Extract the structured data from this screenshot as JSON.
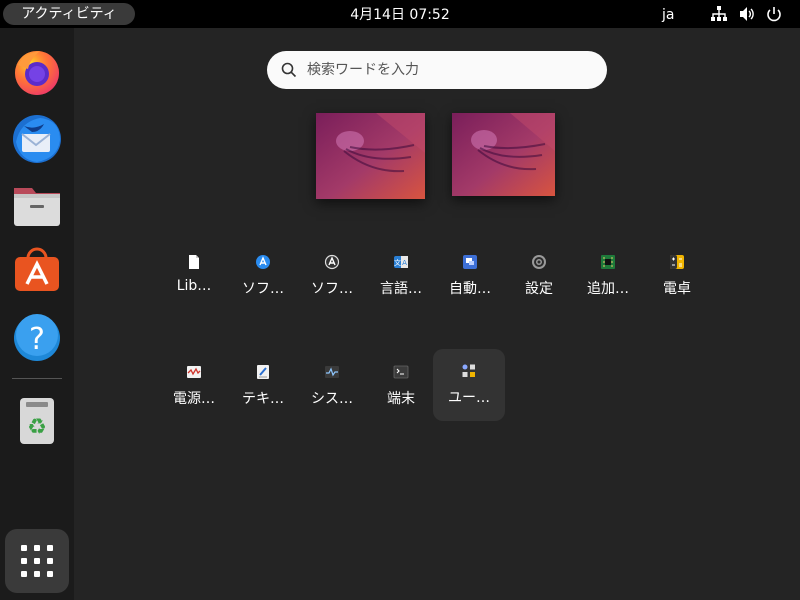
{
  "topbar": {
    "activities": "アクティビティ",
    "clock": "4月14日  07:52",
    "input_method": "ja",
    "tray_icons": [
      "network-icon",
      "volume-icon",
      "power-icon"
    ]
  },
  "dock": {
    "items": [
      {
        "name": "firefox-icon"
      },
      {
        "name": "thunderbird-icon"
      },
      {
        "name": "files-icon"
      },
      {
        "name": "app-center-icon"
      },
      {
        "name": "help-icon"
      },
      {
        "name": "trash-icon"
      }
    ],
    "show_apps": "app-grid-icon"
  },
  "search": {
    "placeholder": "検索ワードを入力"
  },
  "workspaces": [
    {
      "name": "workspace-1"
    },
    {
      "name": "workspace-2"
    }
  ],
  "apps": {
    "row1": [
      {
        "label": "Lib…",
        "icon": "document-icon"
      },
      {
        "label": "ソフ…",
        "icon": "software-icon"
      },
      {
        "label": "ソフ…",
        "icon": "software-updater-icon"
      },
      {
        "label": "言語…",
        "icon": "language-icon"
      },
      {
        "label": "自動…",
        "icon": "automation-icon"
      },
      {
        "label": "設定",
        "icon": "settings-icon"
      },
      {
        "label": "追加…",
        "icon": "chip-icon"
      },
      {
        "label": "電卓",
        "icon": "calculator-icon"
      }
    ],
    "row2": [
      {
        "label": "電源…",
        "icon": "power-stats-icon"
      },
      {
        "label": "テキ…",
        "icon": "text-editor-icon"
      },
      {
        "label": "シス…",
        "icon": "system-monitor-icon"
      },
      {
        "label": "端末",
        "icon": "terminal-icon"
      },
      {
        "label": "ユー…",
        "icon": "utilities-folder-icon"
      }
    ]
  }
}
